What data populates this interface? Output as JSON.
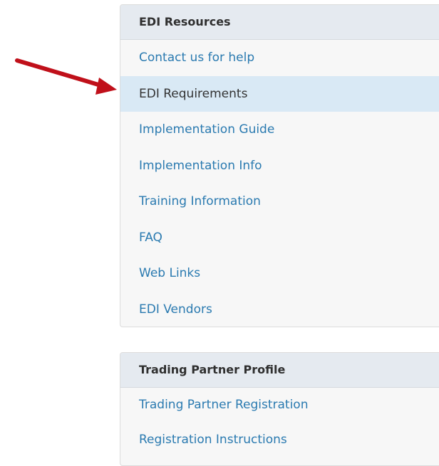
{
  "resources": {
    "title": "EDI Resources",
    "items": [
      {
        "label": "Contact us for help"
      },
      {
        "label": "EDI Requirements"
      },
      {
        "label": "Implementation Guide"
      },
      {
        "label": "Implementation Info"
      },
      {
        "label": "Training Information"
      },
      {
        "label": "FAQ"
      },
      {
        "label": "Web Links"
      },
      {
        "label": "EDI Vendors"
      }
    ]
  },
  "trading_partner": {
    "title": "Trading Partner Profile",
    "items": [
      {
        "label": "Trading Partner Registration"
      },
      {
        "label": "Registration Instructions"
      }
    ]
  },
  "colors": {
    "link": "#2a7ab0",
    "active_bg": "#d9e9f5",
    "header_bg": "#e5eaf0",
    "arrow": "#c0101a"
  },
  "icons": {
    "pointer": "arrow-icon"
  }
}
